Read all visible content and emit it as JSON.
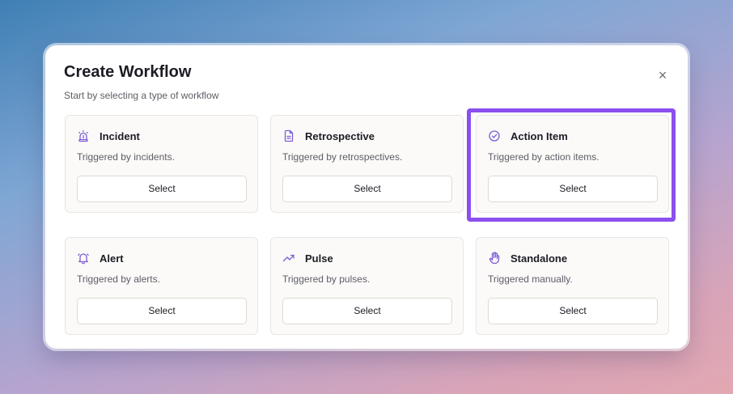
{
  "modal": {
    "title": "Create Workflow",
    "subtitle": "Start by selecting a type of workflow",
    "close_glyph": "×"
  },
  "colors": {
    "accent": "#8b4ff0",
    "icon": "#7c5cd6"
  },
  "cards": [
    {
      "title": "Incident",
      "description": "Triggered by incidents.",
      "button": "Select",
      "icon": "siren-icon"
    },
    {
      "title": "Retrospective",
      "description": "Triggered by retrospectives.",
      "button": "Select",
      "icon": "document-icon"
    },
    {
      "title": "Action Item",
      "description": "Triggered by action items.",
      "button": "Select",
      "icon": "check-circle-icon"
    },
    {
      "title": "Alert",
      "description": "Triggered by alerts.",
      "button": "Select",
      "icon": "bell-icon"
    },
    {
      "title": "Pulse",
      "description": "Triggered by pulses.",
      "button": "Select",
      "icon": "trending-up-icon"
    },
    {
      "title": "Standalone",
      "description": "Triggered manually.",
      "button": "Select",
      "icon": "hand-icon"
    }
  ]
}
